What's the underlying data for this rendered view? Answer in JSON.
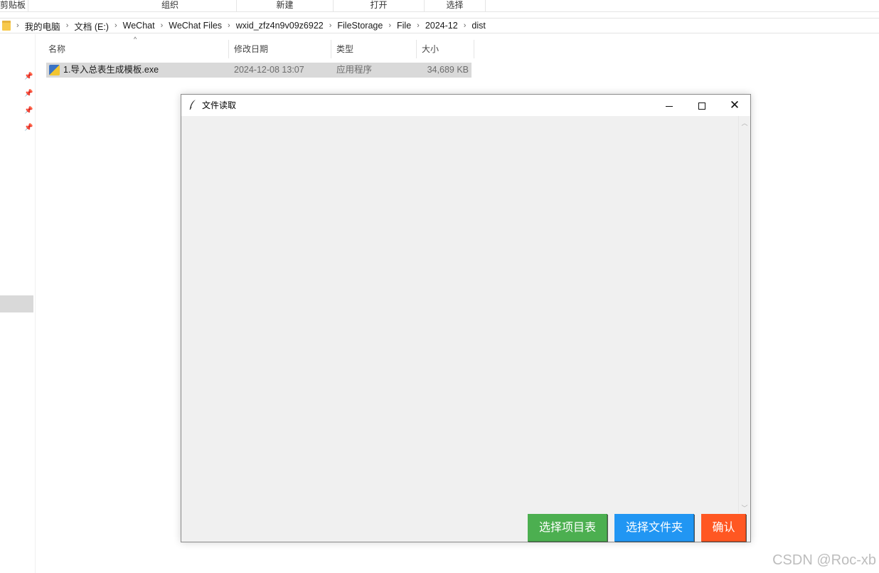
{
  "ribbon": {
    "groups": [
      "剪贴板",
      "组织",
      "新建",
      "打开",
      "选择"
    ]
  },
  "address": {
    "crumbs": [
      "我的电脑",
      "文档 (E:)",
      "WeChat",
      "WeChat Files",
      "wxid_zfz4n9v09z6922",
      "FileStorage",
      "File",
      "2024-12",
      "dist"
    ]
  },
  "columns": {
    "name": "名称",
    "modified": "修改日期",
    "type": "类型",
    "size": "大小"
  },
  "file": {
    "name": "1.导入总表生成模板.exe",
    "modified": "2024-12-08 13:07",
    "type": "应用程序",
    "size": "34,689 KB"
  },
  "window": {
    "title": "文件读取",
    "buttons": {
      "select_table": "选择项目表",
      "select_folder": "选择文件夹",
      "confirm": "确认"
    },
    "colors": {
      "green": "#4caf50",
      "blue": "#2196f3",
      "orange": "#ff5722"
    }
  },
  "watermark": "CSDN @Roc-xb"
}
